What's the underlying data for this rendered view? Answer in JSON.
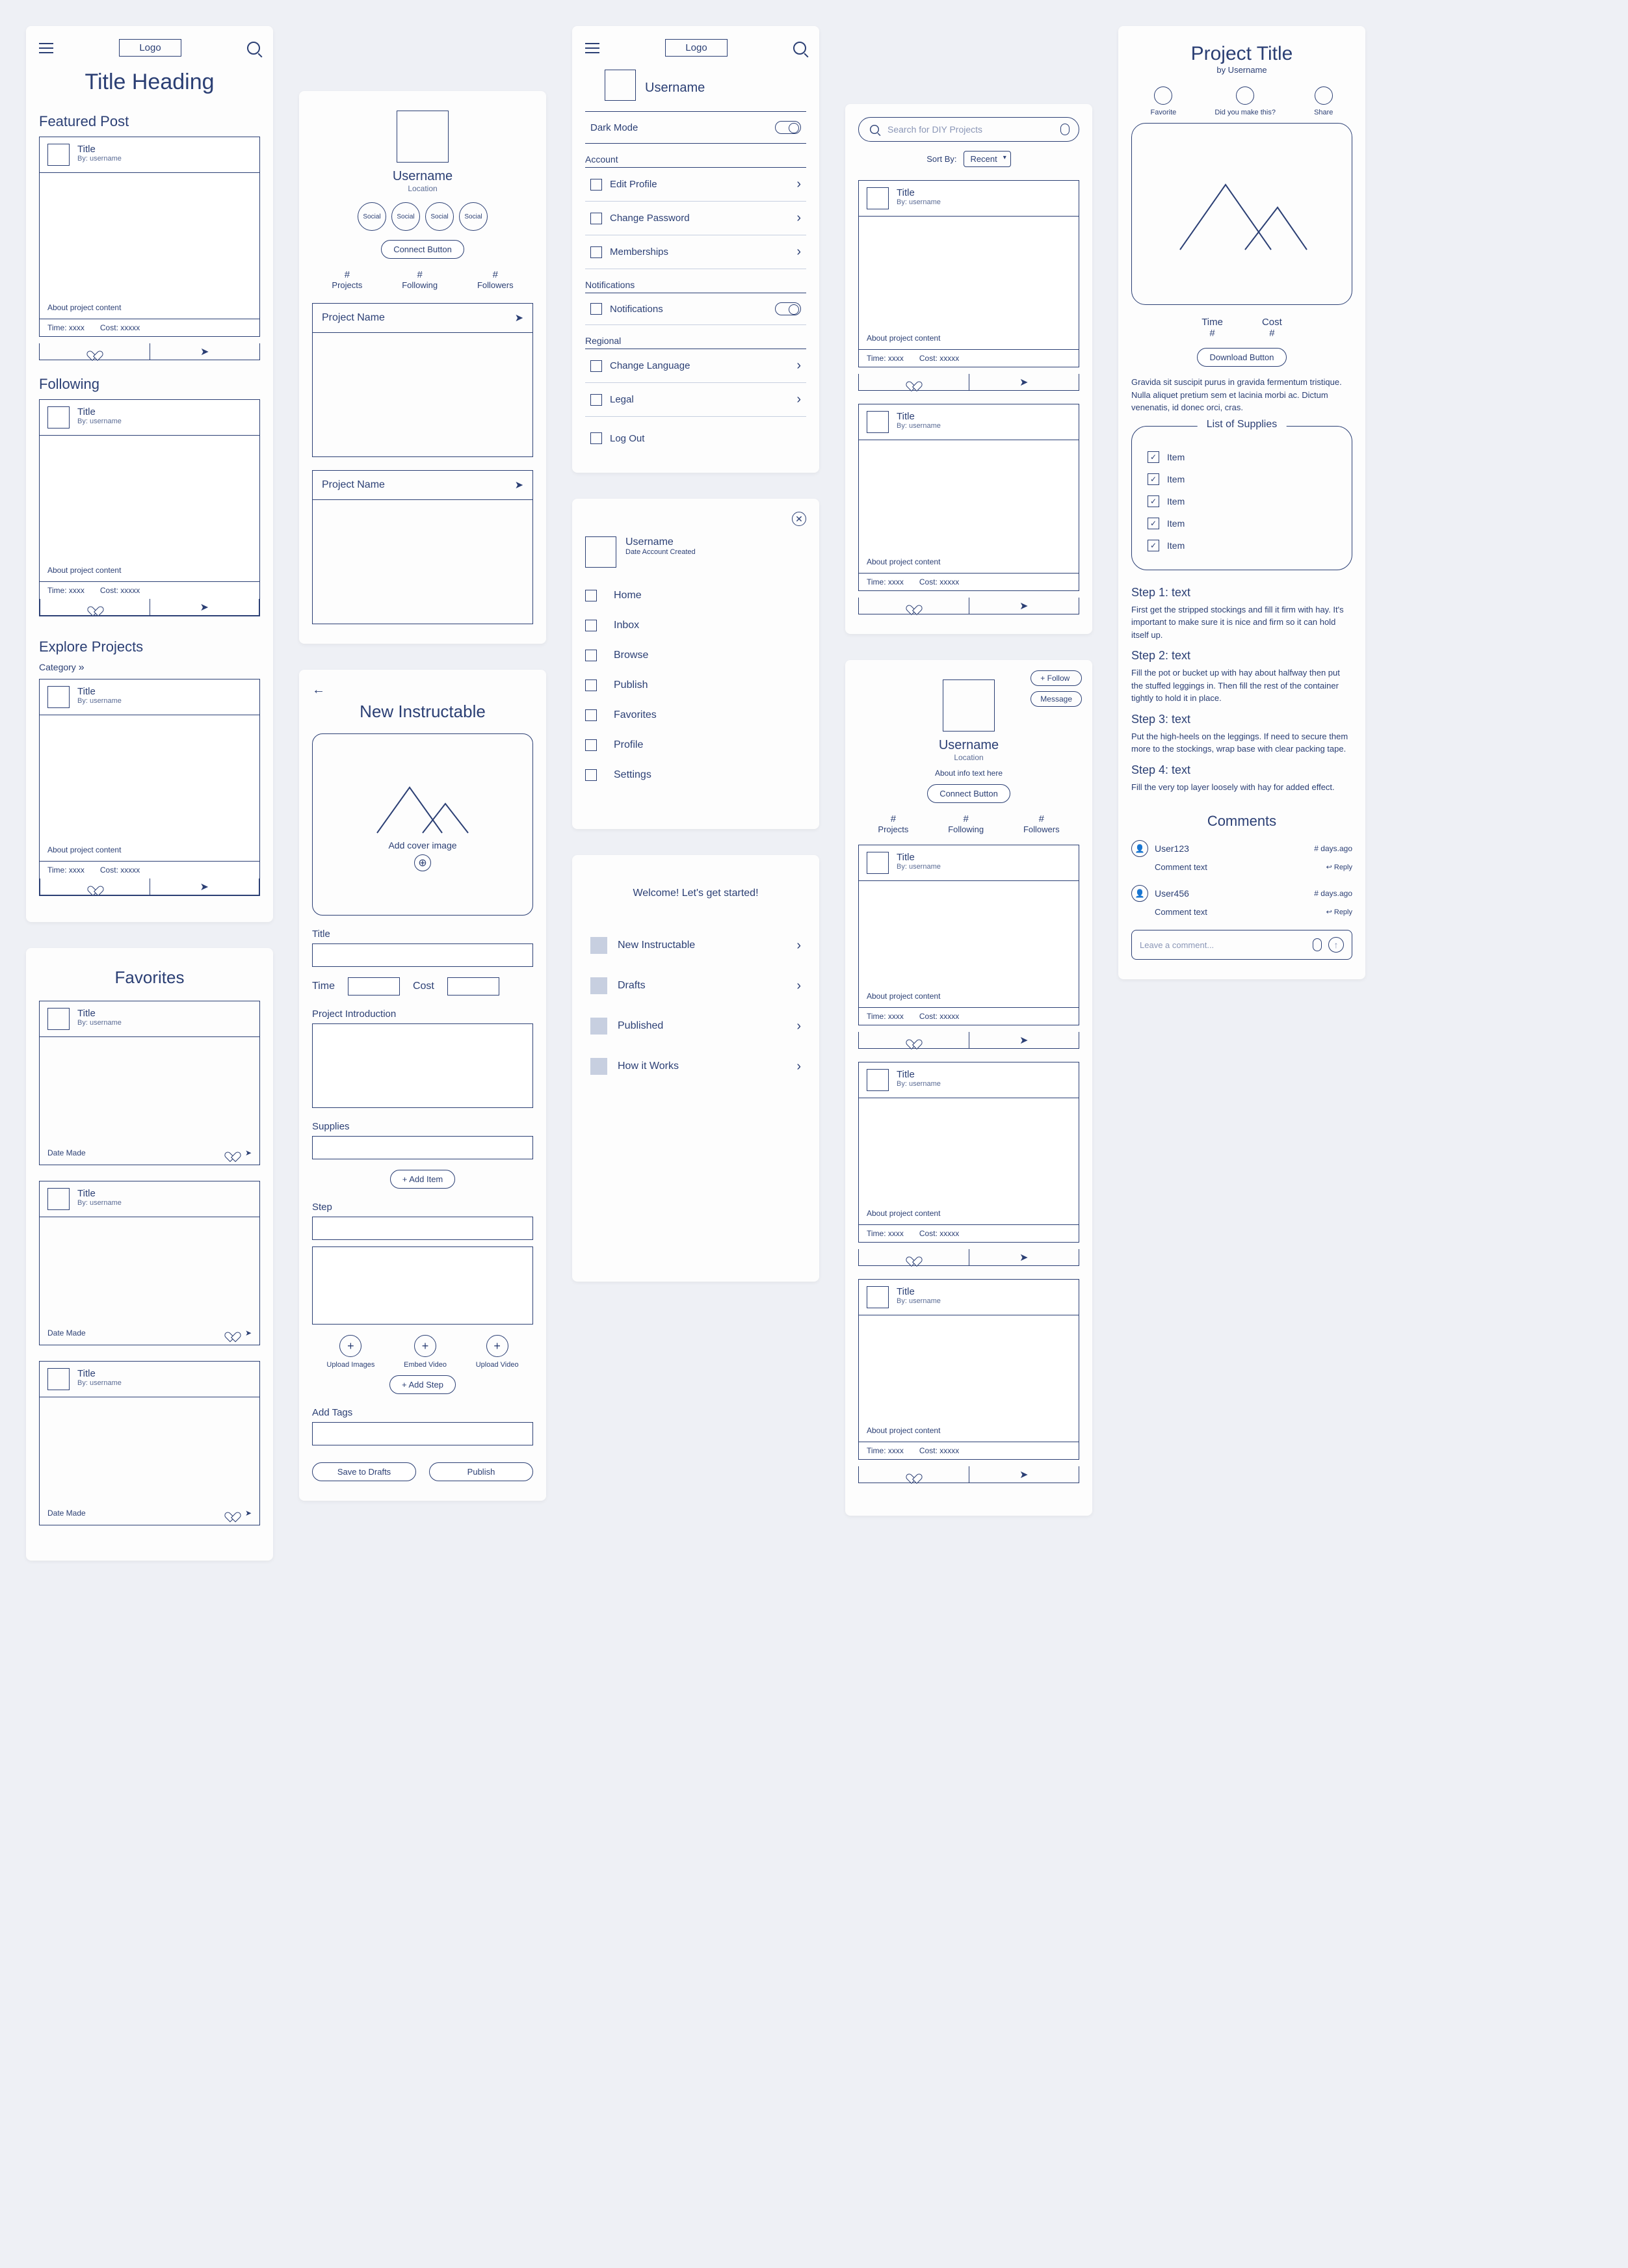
{
  "common": {
    "logo": "Logo",
    "title_placeholder": "Title",
    "by_placeholder": "By: username",
    "about": "About project content",
    "time": "Time: xxxx",
    "cost": "Cost: xxxxx",
    "username": "Username",
    "location": "Location",
    "share_glyph": "➤"
  },
  "home": {
    "heading": "Title Heading",
    "featured": "Featured Post",
    "following": "Following",
    "explore": "Explore Projects",
    "category": "Category"
  },
  "favorites": {
    "title": "Favorites",
    "date_made": "Date Made"
  },
  "profile": {
    "social": "Social",
    "connect": "Connect Button",
    "stats": {
      "projects_n": "#",
      "following_n": "#",
      "followers_n": "#",
      "projects": "Projects",
      "following": "Following",
      "followers": "Followers"
    },
    "project_name": "Project Name"
  },
  "new_instructable": {
    "title": "New Instructable",
    "cover": "Add cover image",
    "title_lbl": "Title",
    "time_lbl": "Time",
    "cost_lbl": "Cost",
    "intro_lbl": "Project Introduction",
    "supplies_lbl": "Supplies",
    "add_item": "Add Item",
    "step_lbl": "Step",
    "upload_images": "Upload Images",
    "embed_video": "Embed Video",
    "upload_video": "Upload Video",
    "add_step": "Add Step",
    "tags_lbl": "Add Tags",
    "save": "Save to Drafts",
    "publish": "Publish"
  },
  "settings": {
    "dark_mode": "Dark Mode",
    "account": "Account",
    "edit_profile": "Edit Profile",
    "change_password": "Change Password",
    "memberships": "Memberships",
    "notifications": "Notifications",
    "notifications_item": "Notifications",
    "regional": "Regional",
    "change_language": "Change Language",
    "legal": "Legal",
    "log_out": "Log Out"
  },
  "drawer": {
    "date_created": "Date Account Created",
    "items": [
      "Home",
      "Inbox",
      "Browse",
      "Publish",
      "Favorites",
      "Profile",
      "Settings"
    ]
  },
  "welcome": {
    "heading": "Welcome! Let's get started!",
    "items": [
      "New Instructable",
      "Drafts",
      "Published",
      "How it Works"
    ]
  },
  "search": {
    "placeholder": "Search for DIY Projects",
    "sort_by": "Sort By:",
    "recent": "Recent"
  },
  "other_profile": {
    "follow": "Follow",
    "message": "Message",
    "about_info": "About info text here"
  },
  "project_detail": {
    "title": "Project Title",
    "by": "by Username",
    "favorite": "Favorite",
    "did_you": "Did you make this?",
    "share": "Share",
    "time": "Time",
    "time_v": "#",
    "cost": "Cost",
    "cost_v": "#",
    "download": "Download Button",
    "desc": "Gravida sit suscipit purus in gravida fermentum tristique. Nulla aliquet pretium sem et lacinia morbi ac. Dictum venenatis, id donec orci, cras.",
    "supplies_h": "List of Supplies",
    "supply": "Item",
    "steps": [
      {
        "h": "Step 1: text",
        "p": "First get the stripped stockings and fill it firm with hay. It's important to make sure it is nice and firm so it can hold itself up."
      },
      {
        "h": "Step 2: text",
        "p": "Fill the pot or bucket up with hay about halfway then put the stuffed leggings in. Then fill the rest of the container tightly to hold it in place."
      },
      {
        "h": "Step 3: text",
        "p": "Put the high-heels on the leggings. If need to secure them more to the stockings, wrap base with clear packing tape."
      },
      {
        "h": "Step 4: text",
        "p": "Fill the very top layer loosely with hay for added effect."
      }
    ],
    "comments_h": "Comments",
    "comments": [
      {
        "user": "User123",
        "ago": "# days.ago",
        "text": "Comment text",
        "reply": "Reply"
      },
      {
        "user": "User456",
        "ago": "# days.ago",
        "text": "Comment text",
        "reply": "Reply"
      }
    ],
    "leave": "Leave a comment..."
  }
}
